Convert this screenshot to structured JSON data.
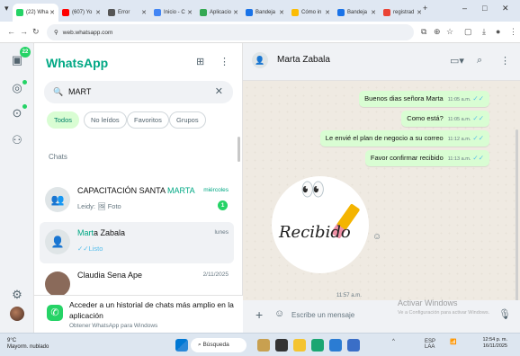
{
  "browser": {
    "tabs": [
      {
        "label": "(22) Wha",
        "active": true,
        "color": "#25d366"
      },
      {
        "label": "(607) Yo",
        "active": false,
        "color": "#ff0000"
      },
      {
        "label": "Error",
        "active": false,
        "color": "#555555"
      },
      {
        "label": "Inicio - C",
        "active": false,
        "color": "#4285f4"
      },
      {
        "label": "Aplicacio",
        "active": false,
        "color": "#34a853"
      },
      {
        "label": "Bandeja",
        "active": false,
        "color": "#1a73e8"
      },
      {
        "label": "Cómo in",
        "active": false,
        "color": "#fbbc04"
      },
      {
        "label": "Bandeja",
        "active": false,
        "color": "#1a73e8"
      },
      {
        "label": "registrad",
        "active": false,
        "color": "#ea4335"
      }
    ],
    "url": "web.whatsapp.com"
  },
  "rail": {
    "badge": "22"
  },
  "sidebar": {
    "title": "WhatsApp",
    "search_value": "MART",
    "filters": [
      {
        "label": "Todos",
        "active": true
      },
      {
        "label": "No leídos",
        "active": false
      },
      {
        "label": "Favoritos",
        "active": false
      },
      {
        "label": "Grupos",
        "active": false
      }
    ],
    "section_label": "Chats",
    "chats": [
      {
        "name_pre": "CAPACITACIÓN SANTA ",
        "name_hl": "MARTA",
        "name_post": "",
        "preview": "Leidy: 🖼 Foto",
        "time": "miércoles",
        "unread": "1"
      },
      {
        "name_pre": "",
        "name_hl": "Mart",
        "name_post": "a Zabala",
        "preview": "✓✓Listo",
        "time": "lunes",
        "unread": ""
      },
      {
        "name_pre": "Claudia Sena Ape",
        "name_hl": "",
        "name_post": "",
        "preview": "",
        "time": "2/11/2025",
        "unread": ""
      }
    ],
    "promo_title": "Acceder a un historial de chats más amplio en la aplicación",
    "promo_sub": "Obtener WhatsApp para Windows"
  },
  "chat": {
    "contact": "Marta Zabala",
    "messages": [
      {
        "text": "Buenos dias señora Marta",
        "time": "11:05 a.m."
      },
      {
        "text": "Como está?",
        "time": "11:05 a.m."
      },
      {
        "text": "Le envié el plan de negocio a su correo",
        "time": "11:12 a.m."
      },
      {
        "text": "Favor confirmar recibido",
        "time": "11:13 a.m."
      }
    ],
    "sticker_text": "Recibido",
    "sticker_time": "11:57 a.m.",
    "input_placeholder": "Escribe un mensaje",
    "watermark_title": "Activar Windows",
    "watermark_sub": "Ve a Configuración para activar Windows."
  },
  "taskbar": {
    "weather_temp": "9°C",
    "weather_desc": "Mayorm. nublado",
    "search_label": "Búsqueda",
    "lang": "ESP",
    "lang2": "LAA",
    "time": "12:54 p. m.",
    "date": "16/11/2025"
  }
}
